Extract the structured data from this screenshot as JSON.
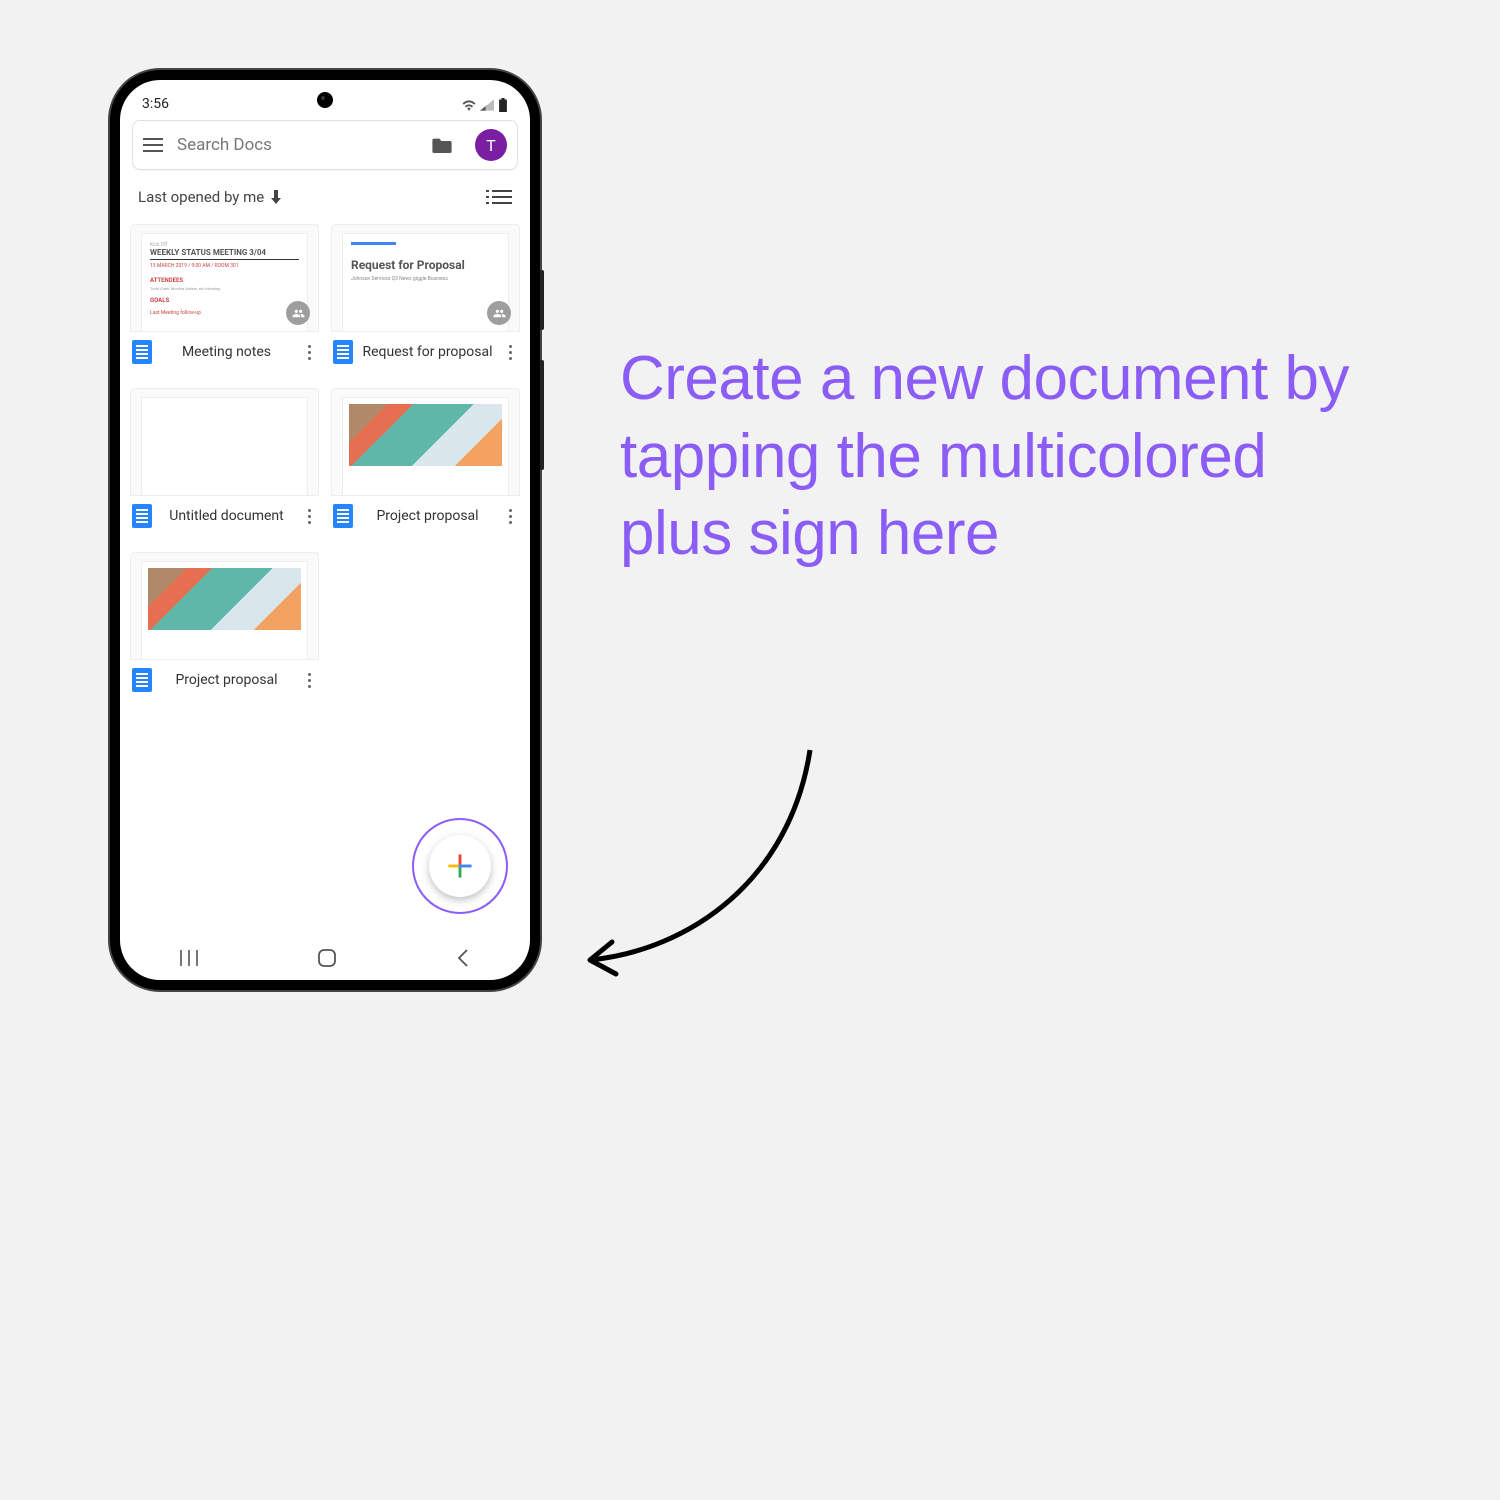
{
  "statusbar": {
    "time": "3:56"
  },
  "search": {
    "placeholder": "Search Docs",
    "avatar_letter": "T"
  },
  "sort": {
    "label": "Last opened by me"
  },
  "docs": [
    {
      "title": "Meeting notes",
      "shared": true,
      "thumb": {
        "heading": "WEEKLY STATUS MEETING 3/04",
        "sub": "ATTENDEES"
      }
    },
    {
      "title": "Request for proposal",
      "shared": true,
      "thumb": {
        "heading": "Request for Proposal",
        "sub": "Johnson Services Q3 News giggle Business"
      }
    },
    {
      "title": "Untitled document",
      "thumb": {
        "blank": true
      }
    },
    {
      "title": "Project proposal",
      "thumb": {
        "material": true
      }
    },
    {
      "title": "Project proposal",
      "thumb": {
        "material": true
      }
    }
  ],
  "annotation": "Create a new document by tapping the multicolored plus sign here"
}
